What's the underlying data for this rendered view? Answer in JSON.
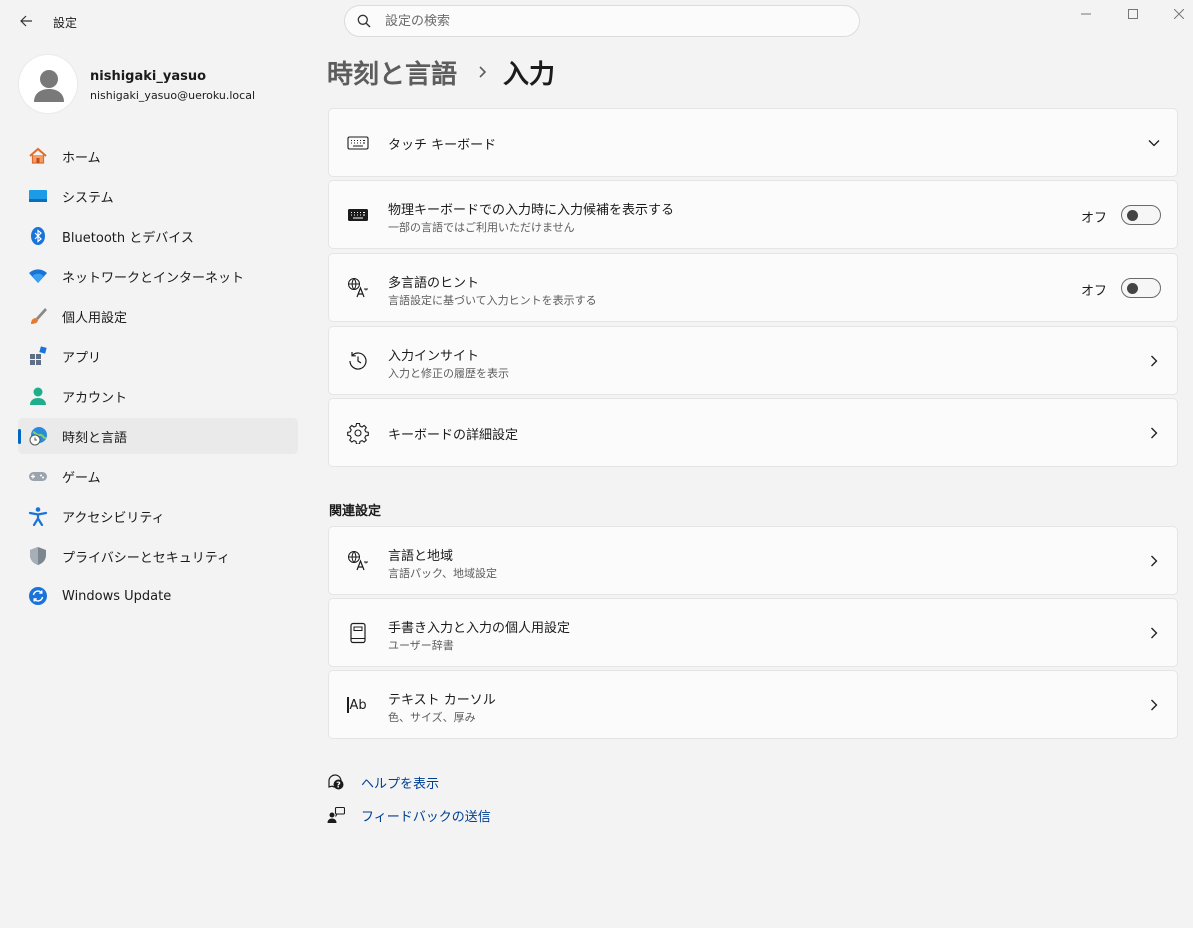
{
  "window": {
    "title": "設定"
  },
  "search": {
    "placeholder": "設定の検索",
    "value": ""
  },
  "profile": {
    "name": "nishigaki_yasuo",
    "email": "nishigaki_yasuo@ueroku.local"
  },
  "sidebar": {
    "items": [
      {
        "label": "ホーム",
        "icon": "home-icon"
      },
      {
        "label": "システム",
        "icon": "system-icon"
      },
      {
        "label": "Bluetooth とデバイス",
        "icon": "bluetooth-icon"
      },
      {
        "label": "ネットワークとインターネット",
        "icon": "wifi-icon"
      },
      {
        "label": "個人用設定",
        "icon": "brush-icon"
      },
      {
        "label": "アプリ",
        "icon": "apps-icon"
      },
      {
        "label": "アカウント",
        "icon": "account-icon"
      },
      {
        "label": "時刻と言語",
        "icon": "time-language-icon",
        "active": true
      },
      {
        "label": "ゲーム",
        "icon": "gamepad-icon"
      },
      {
        "label": "アクセシビリティ",
        "icon": "accessibility-icon"
      },
      {
        "label": "プライバシーとセキュリティ",
        "icon": "shield-icon"
      },
      {
        "label": "Windows Update",
        "icon": "update-icon"
      }
    ]
  },
  "breadcrumb": {
    "parent": "時刻と言語",
    "current": "入力"
  },
  "cards": [
    {
      "title": "タッチ キーボード",
      "icon": "touch-keyboard-icon",
      "action": "expand"
    },
    {
      "title": "物理キーボードでの入力時に入力候補を表示する",
      "subtitle": "一部の言語ではご利用いただけません",
      "icon": "keyboard-icon",
      "toggle_label": "オフ",
      "toggle_on": false
    },
    {
      "title": "多言語のヒント",
      "subtitle": "言語設定に基づいて入力ヒントを表示する",
      "icon": "language-icon",
      "toggle_label": "オフ",
      "toggle_on": false
    },
    {
      "title": "入力インサイト",
      "subtitle": "入力と修正の履歴を表示",
      "icon": "history-icon",
      "action": "navigate"
    },
    {
      "title": "キーボードの詳細設定",
      "icon": "gear-icon",
      "action": "navigate"
    }
  ],
  "related": {
    "title": "関連設定",
    "cards": [
      {
        "title": "言語と地域",
        "subtitle": "言語パック、地域設定",
        "icon": "language-icon"
      },
      {
        "title": "手書き入力と入力の個人用設定",
        "subtitle": "ユーザー辞書",
        "icon": "notebook-icon"
      },
      {
        "title": "テキスト カーソル",
        "subtitle": "色、サイズ、厚み",
        "icon": "text-cursor-icon",
        "icon_text": "Ab"
      }
    ]
  },
  "help_links": [
    {
      "label": "ヘルプを表示",
      "icon": "help-icon"
    },
    {
      "label": "フィードバックの送信",
      "icon": "feedback-icon"
    }
  ],
  "colors": {
    "accent": "#0067c0",
    "link": "#003e92",
    "background": "#f3f3f3",
    "card": "#fbfbfb"
  }
}
